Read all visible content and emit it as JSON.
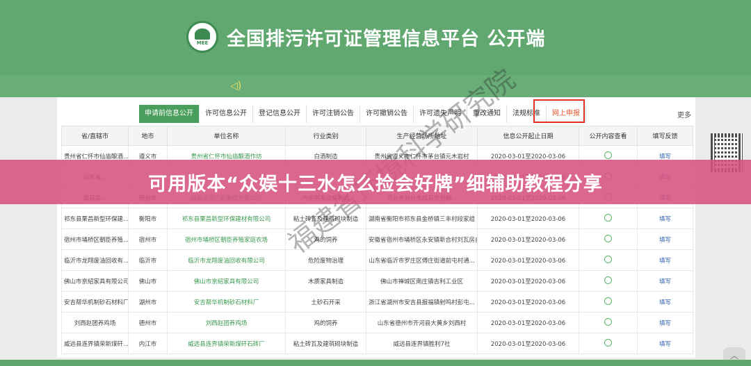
{
  "header": {
    "logo_text": "MEE",
    "title": "全国排污许可证管理信息平台  公开端"
  },
  "tabs": [
    {
      "label": "申请前信息公开",
      "state": "active"
    },
    {
      "label": "许可信息公开",
      "state": ""
    },
    {
      "label": "登记信息公开",
      "state": ""
    },
    {
      "label": "许可注销公告",
      "state": ""
    },
    {
      "label": "许可撤销公告",
      "state": ""
    },
    {
      "label": "许可遗失声明",
      "state": ""
    },
    {
      "label": "重改通知",
      "state": ""
    },
    {
      "label": "法规标准",
      "state": ""
    },
    {
      "label": "网上申报",
      "state": "highlight"
    }
  ],
  "more_label": "更多",
  "table": {
    "columns": [
      "省/直辖市",
      "地市",
      "单位名称",
      "行业类别",
      "生产经营场所地址",
      "信息公开起止日期",
      "公开内容查看",
      "填写反馈"
    ],
    "rows": [
      [
        "贵州省仁怀市仙庙酿酒...",
        "遵义市",
        "贵州省仁怀市仙庙酿酒作坊",
        "白酒制造",
        "贵州省遵义市仁怀市茅台镇元木岩村",
        "2020-03-01至2020-03-06",
        "",
        "填写"
      ],
      [
        "山东省...",
        "",
        "",
        "",
        "",
        "2020-03-01至2020-03-06",
        "",
        "填写"
      ],
      [
        "威县吴...",
        "邢台市",
        "威县吴阳汽配制造有限公司",
        "汽车用发动机制造",
        "河北省邢台市威县贺营镇...",
        "2020-03-01至2020-03-06",
        "",
        "填写"
      ],
      [
        "祁东县栗昌新型环保建...",
        "衡阳市",
        "祁东县栗昌新型环保建材有限公司",
        "粘土砖瓦及建筑砌块制造",
        "湖南省衡阳市祁东县金桥镇三丰村段家组",
        "2020-03-01至2020-03-06",
        "",
        "填写"
      ],
      [
        "宿州市埇桥区朝臣养殖...",
        "宿州市",
        "宿州市埇桥区朝臣养殖家庭农场",
        "鸡的饲养",
        "安徽省宿州市埇桥区永安镇新合村刘瓦房自然村",
        "2020-03-01至2020-03-06",
        "",
        "填写"
      ],
      [
        "临沂市龙翔废油回收有...",
        "临沂市",
        "临沂市龙翔废油回收有限公司",
        "危险废物治理",
        "山东省临沂市罗庄区傅庄街道前屯村通...",
        "2020-03-01至2020-03-06",
        "",
        "填写"
      ],
      [
        "佛山市京紹家具有限公司",
        "佛山市",
        "佛山市京紹家具有限公司",
        "木质家具制造",
        "佛山市禅城区南庄镇吉利工业区",
        "2020-03-01至2020-03-06",
        "",
        "填写"
      ],
      [
        "安吉帮华机制砂石材料厂",
        "湖州市",
        "安吉帮华机制砂石材料厂",
        "土砂石开采",
        "浙江省湖州市安吉县报福镇射鸣村彭屯...",
        "2020-03-01至2020-03-06",
        "",
        "填写"
      ],
      [
        "刘西赵团养鸡场",
        "德州市",
        "刘西赵团养鸡场",
        "鸡的饲养",
        "山东省德州市齐河县大黄乡刘西村",
        "2020-03-01至2020-03-06",
        "",
        "填写"
      ],
      [
        "威远县连界镇荣新煤矸...",
        "内江市",
        "威远县连界镇荣新煤矸石砖厂",
        "粘土砖瓦及建筑砌块制造",
        "威远县连界镇胜利7社",
        "2020-03-01至2020-03-06",
        "",
        "填写"
      ]
    ]
  },
  "watermark": "福建省环境科学研究院",
  "banner": {
    "text": "可用版本“众娱十三水怎么捡会好牌”细辅助教程分享"
  },
  "colors": {
    "header_green": "#60a870",
    "tab_active": "#4a9e5c",
    "link_green": "#3b9a4e",
    "feedback_blue": "#2d5fb3",
    "highlight_red": "#e0301e",
    "banner_pink": "#d65280"
  },
  "icons": {
    "speaker": "speaker-icon",
    "view": "eye-icon",
    "scroll_top": "chevron-up-icon"
  }
}
